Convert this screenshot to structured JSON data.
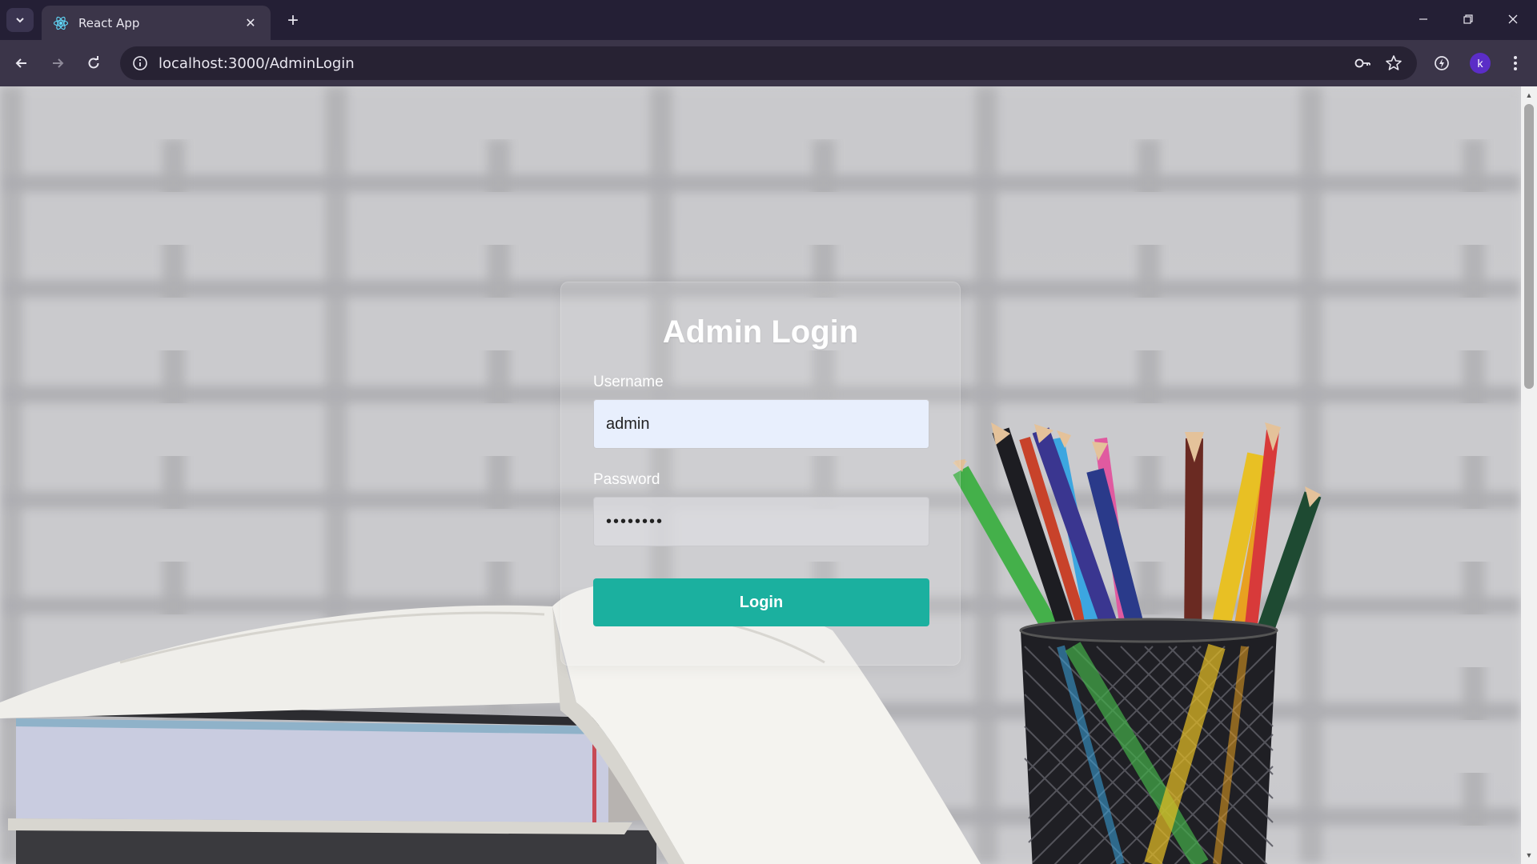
{
  "browser": {
    "tab_title": "React App",
    "url": "localhost:3000/AdminLogin",
    "profile_initial": "k"
  },
  "login": {
    "title": "Admin Login",
    "username_label": "Username",
    "username_value": "admin",
    "password_label": "Password",
    "password_value": "••••••••",
    "button_label": "Login"
  },
  "colors": {
    "accent": "#1bb09f",
    "titlebar": "#241f35",
    "toolbar": "#3b3549"
  }
}
